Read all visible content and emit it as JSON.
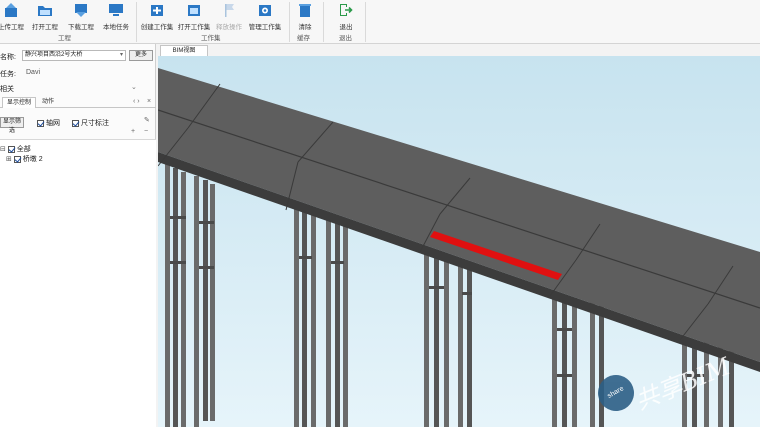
{
  "ribbon": {
    "buttons": [
      {
        "id": "upload",
        "label": "上传工程"
      },
      {
        "id": "open",
        "label": "打开工程"
      },
      {
        "id": "download",
        "label": "下载工程"
      },
      {
        "id": "local",
        "label": "本地任务"
      },
      {
        "id": "create_ws",
        "label": "创建工作集"
      },
      {
        "id": "open_ws",
        "label": "打开工作集"
      },
      {
        "id": "release",
        "label": "释放操作"
      },
      {
        "id": "manage_ws",
        "label": "管理工作集"
      },
      {
        "id": "clear",
        "label": "清除"
      },
      {
        "id": "exit",
        "label": "退出"
      }
    ],
    "groups": {
      "project": "工程",
      "workset": "工作集",
      "cache": "缓存",
      "exit": "退出"
    }
  },
  "left": {
    "name_label": "名称:",
    "name_value": "静兴项目西沿2号大桥",
    "select_button": "更多",
    "user_label": "任务:",
    "user_value": "Davi",
    "related_label": "相关",
    "tabs": [
      "显示控制",
      "动作"
    ],
    "filter_button": "显示筛选",
    "axis_label": "轴网",
    "dimension_label": "尺寸标注",
    "tree_root": "全部",
    "tree_child": "桥墩 2"
  },
  "viewport": {
    "tab_label": "BIM视图"
  },
  "watermark": {
    "badge": "share",
    "text": "共享BIM"
  },
  "colors": {
    "accent_blue": "#2b78c5",
    "highlight_red": "#e01010",
    "deck_gray": "#5e5e5e"
  }
}
